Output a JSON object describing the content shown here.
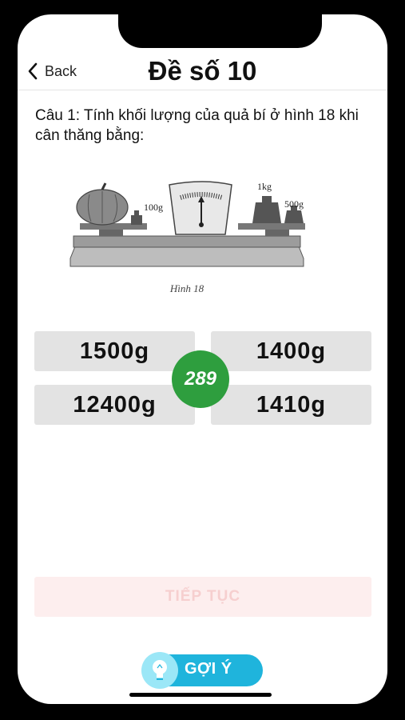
{
  "nav": {
    "back_label": "Back",
    "title": "Đề số 10"
  },
  "question": {
    "text": "Câu 1: Tính khối lượng của quả bí ở hình 18 khi cân thăng bằng:"
  },
  "figure": {
    "weight_left": "100g",
    "weight_right_1": "1kg",
    "weight_right_2": "500g",
    "caption": "Hình 18"
  },
  "answers": [
    "1500g",
    "1400g",
    "12400g",
    "1410g"
  ],
  "counter": "289",
  "next_label": "TIẾP TỤC",
  "hint_label": "GỢI Ý",
  "colors": {
    "counter": "#2e9e3e",
    "hint": "#1fb4dc",
    "answer_bg": "#e3e3e3"
  }
}
